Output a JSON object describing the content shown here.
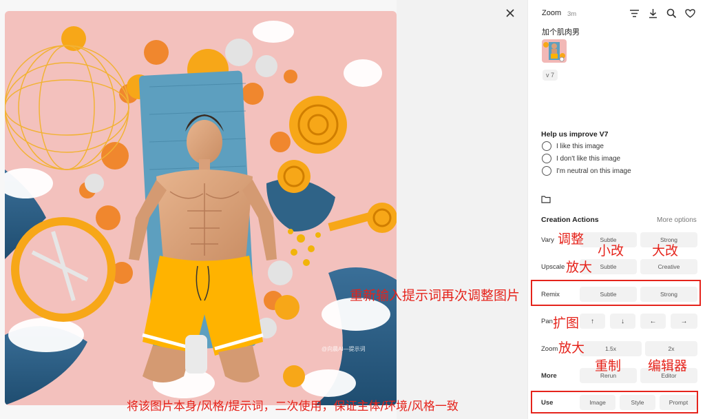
{
  "header": {
    "model": "Zoom",
    "time": "3m",
    "icons": [
      "list-icon",
      "download-icon",
      "search-icon",
      "heart-icon"
    ]
  },
  "prompt": "加个肌肉男",
  "version": "v 7",
  "watermark": "@向晨AI—提示词",
  "help": {
    "title": "Help us improve V7",
    "options": [
      "I like this image",
      "I don't like this image",
      "I'm neutral on this image"
    ]
  },
  "creation": {
    "title": "Creation Actions",
    "more_options": "More options",
    "vary": {
      "label": "Vary",
      "buttons": [
        "Subtle",
        "Strong"
      ]
    },
    "upscale": {
      "label": "Upscale",
      "buttons": [
        "Subtle",
        "Creative"
      ]
    },
    "remix": {
      "label": "Remix",
      "buttons": [
        "Subtle",
        "Strong"
      ]
    },
    "pan": {
      "label": "Pan",
      "buttons": [
        "↑",
        "↓",
        "←",
        "→"
      ]
    },
    "zoom": {
      "label": "Zoom",
      "buttons": [
        "1.5x",
        "2x"
      ]
    },
    "more": {
      "label": "More",
      "buttons": [
        "Rerun",
        "Editor"
      ]
    },
    "use": {
      "label": "Use",
      "buttons": [
        "Image",
        "Style",
        "Prompt"
      ]
    }
  },
  "annotations": {
    "vary": "调整",
    "subtle": "小改",
    "strong": "大改",
    "upscale": "放大",
    "remix": "重新输入提示词再次调整图片",
    "pan": "扩图",
    "zoom": "放大",
    "rerun": "重制",
    "editor": "编辑器",
    "use": "将该图片本身/风格/提示词，二次使用，保证主体/环境/风格一致"
  },
  "colors": {
    "annotation": "#e5231b",
    "button_bg": "#f2f2f2",
    "photo_bg": "#f2b8b6",
    "shorts": "#ffb300"
  }
}
